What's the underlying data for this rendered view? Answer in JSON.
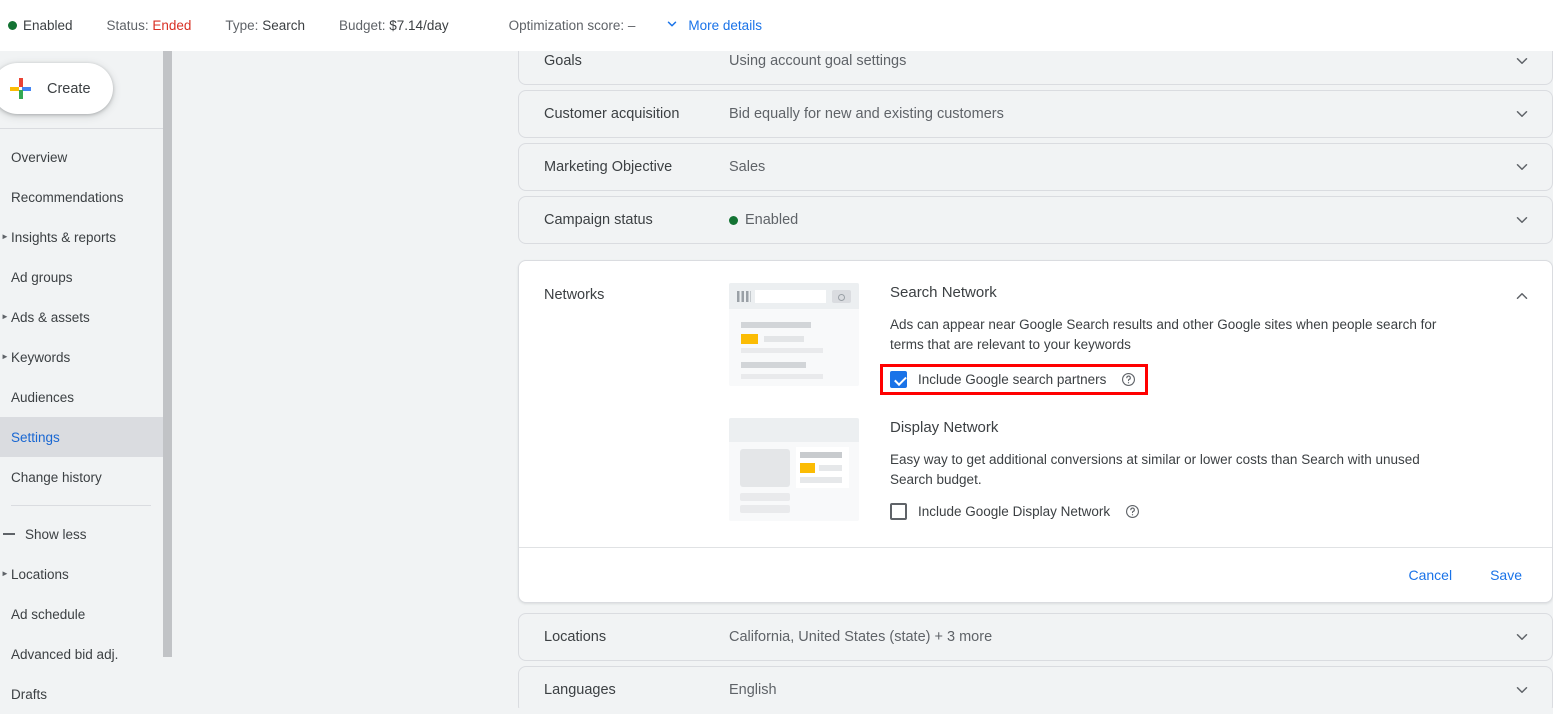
{
  "topbar": {
    "status_indicator": "enabled-dot",
    "enabled_label": "Enabled",
    "status_key": "Status:",
    "status_value": "Ended",
    "type_key": "Type:",
    "type_value": "Search",
    "budget_key": "Budget:",
    "budget_value": "$7.14/day",
    "optimization_score": "Optimization score: –",
    "more_details": "More details",
    "more_details_icon": "chevron-down-icon",
    "enabled_color": "#137333",
    "ended_color": "#d93025",
    "link_color": "#1a73e8"
  },
  "sidebar": {
    "create_label": "Create",
    "create_icon": "google-plus-icon",
    "items": [
      {
        "label": "Overview",
        "expandable": false,
        "active": false
      },
      {
        "label": "Recommendations",
        "expandable": false,
        "active": false
      },
      {
        "label": "Insights & reports",
        "expandable": true,
        "active": false
      },
      {
        "label": "Ad groups",
        "expandable": false,
        "active": false
      },
      {
        "label": "Ads & assets",
        "expandable": true,
        "active": false
      },
      {
        "label": "Keywords",
        "expandable": true,
        "active": false
      },
      {
        "label": "Audiences",
        "expandable": false,
        "active": false
      },
      {
        "label": "Settings",
        "expandable": false,
        "active": true
      },
      {
        "label": "Change history",
        "expandable": false,
        "active": false
      }
    ],
    "show_less": "Show less",
    "items_after": [
      {
        "label": "Locations",
        "expandable": true,
        "active": false
      },
      {
        "label": "Ad schedule",
        "expandable": false,
        "active": false
      },
      {
        "label": "Advanced bid adj.",
        "expandable": false,
        "active": false
      },
      {
        "label": "Drafts",
        "expandable": false,
        "active": false
      }
    ],
    "active_color": "#1967d2",
    "active_bg": "#dadce0"
  },
  "settings": {
    "rows_top": [
      {
        "label": "Goals",
        "value": "Using account goal settings",
        "status_dot": false,
        "chevron": "chevron-down-icon"
      },
      {
        "label": "Customer acquisition",
        "value": "Bid equally for new and existing customers",
        "status_dot": false,
        "chevron": "chevron-down-icon"
      },
      {
        "label": "Marketing Objective",
        "value": "Sales",
        "status_dot": false,
        "chevron": "chevron-down-icon"
      },
      {
        "label": "Campaign status",
        "value": "Enabled",
        "status_dot": true,
        "chevron": "chevron-down-icon"
      }
    ],
    "rows_bottom": [
      {
        "label": "Locations",
        "value": "California, United States (state) + 3 more",
        "status_dot": false,
        "chevron": "chevron-down-icon"
      },
      {
        "label": "Languages",
        "value": "English",
        "status_dot": false,
        "chevron": "chevron-down-icon"
      }
    ]
  },
  "networks_card": {
    "title": "Networks",
    "collapse_icon": "chevron-up-icon",
    "search": {
      "thumbnail": "search-results-preview-thumbnail",
      "heading": "Search Network",
      "description": "Ads can appear near Google Search results and other Google sites when people search for terms that are relevant to your keywords",
      "checkbox_label": "Include Google search partners",
      "checked": true,
      "highlighted": true,
      "highlight_color": "#ff0000",
      "help_icon": "help-circle-icon"
    },
    "display": {
      "thumbnail": "display-ad-preview-thumbnail",
      "heading": "Display Network",
      "description": "Easy way to get additional conversions at similar or lower costs than Search with unused Search budget.",
      "checkbox_label": "Include Google Display Network",
      "checked": false,
      "help_icon": "help-circle-icon"
    },
    "cancel_label": "Cancel",
    "save_label": "Save"
  }
}
